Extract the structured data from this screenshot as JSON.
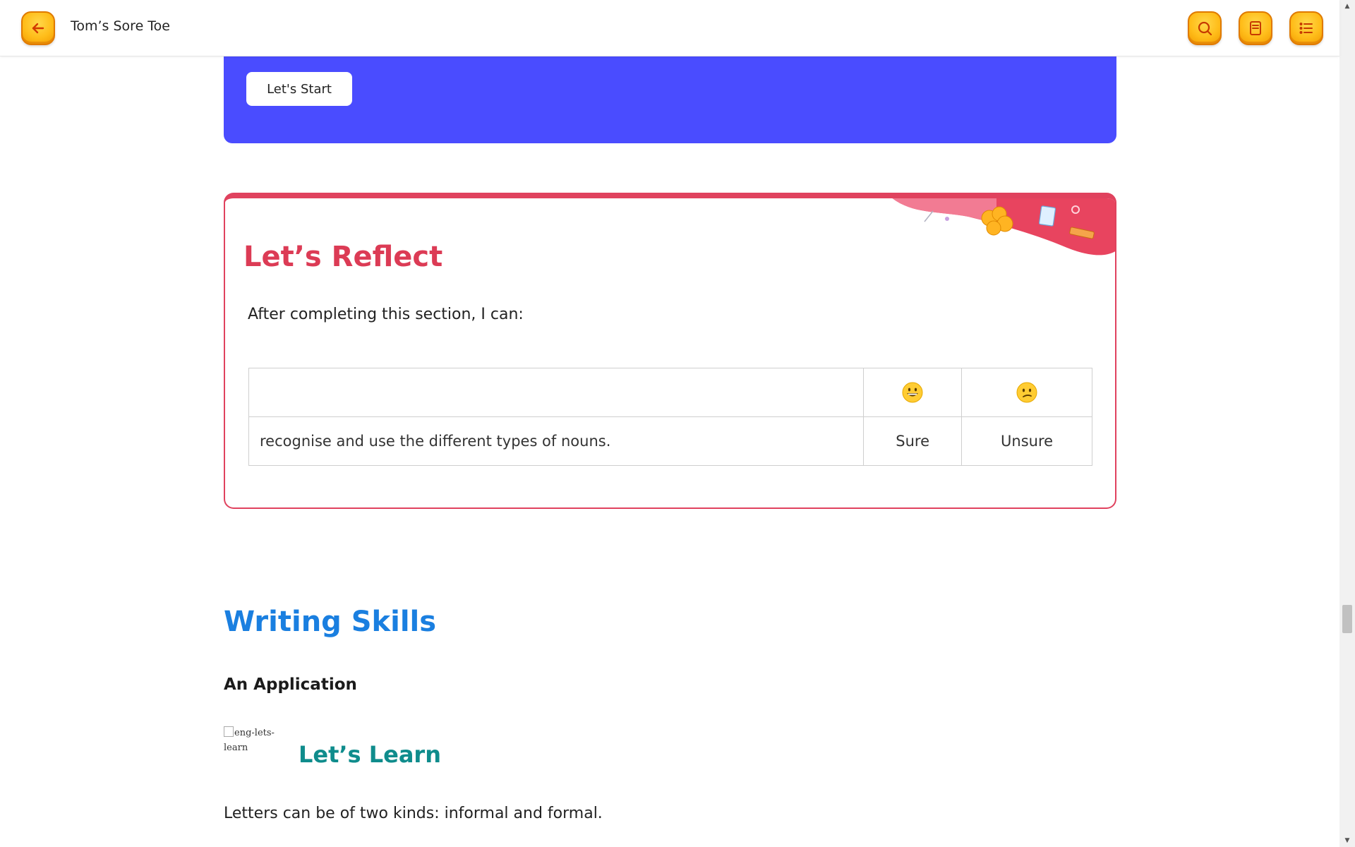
{
  "header": {
    "title": "Tom’s Sore Toe",
    "back_icon": "arrow-left-icon",
    "search_icon": "search-icon",
    "notes_icon": "notebook-icon",
    "menu_icon": "list-icon",
    "accent_color": "#ffbd1a"
  },
  "banner": {
    "start_label": "Let's Start",
    "color": "#4a4cff"
  },
  "reflect": {
    "title": "Let’s Reflect",
    "intro": "After completing this section, I can:",
    "accent_color": "#dc3b55",
    "table": {
      "header_icons": [
        "grinning-face-icon",
        "confused-face-icon"
      ],
      "rows": [
        {
          "statement": "recognise and use the different types of nouns.",
          "sure": "Sure",
          "unsure": "Unsure"
        }
      ]
    }
  },
  "writing": {
    "title": "Writing Skills",
    "subheading": "An Application",
    "image_alt": "eng-lets-learn",
    "learn_heading": "Let’s Learn",
    "paragraph": "Letters can be of two kinds: informal and formal."
  }
}
